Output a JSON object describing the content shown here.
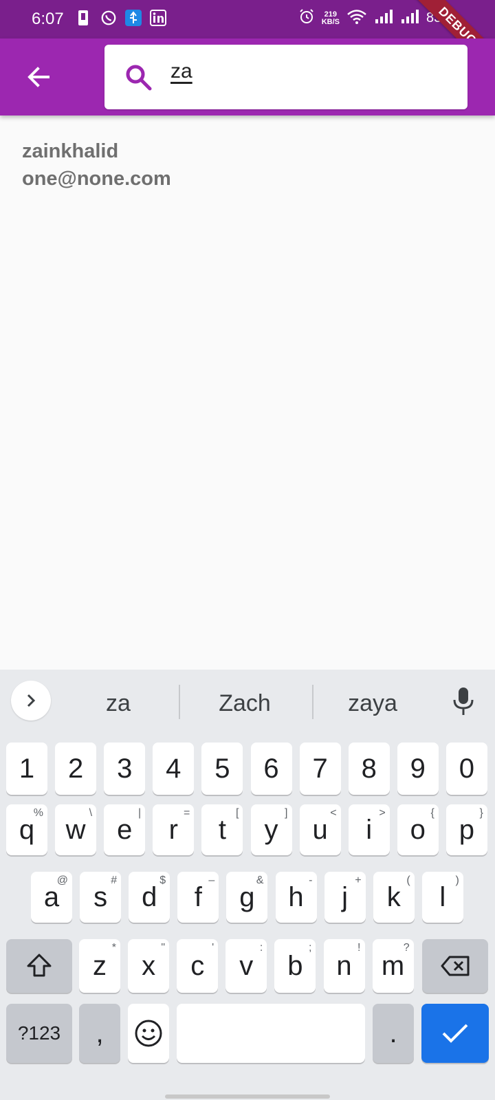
{
  "status": {
    "time": "6:07",
    "net_speed_top": "219",
    "net_speed_unit": "KB/S",
    "battery": "83%",
    "debug": "DEBUG"
  },
  "search": {
    "value": "za"
  },
  "result": {
    "name": "zainkhalid",
    "email": "one@none.com"
  },
  "keyboard": {
    "suggestions": [
      "za",
      "Zach",
      "zaya"
    ],
    "row_numbers": [
      "1",
      "2",
      "3",
      "4",
      "5",
      "6",
      "7",
      "8",
      "9",
      "0"
    ],
    "row1": [
      {
        "k": "q",
        "h": "%"
      },
      {
        "k": "w",
        "h": "\\"
      },
      {
        "k": "e",
        "h": "|"
      },
      {
        "k": "r",
        "h": "="
      },
      {
        "k": "t",
        "h": "["
      },
      {
        "k": "y",
        "h": "]"
      },
      {
        "k": "u",
        "h": "<"
      },
      {
        "k": "i",
        "h": ">"
      },
      {
        "k": "o",
        "h": "{"
      },
      {
        "k": "p",
        "h": "}"
      }
    ],
    "row2": [
      {
        "k": "a",
        "h": "@"
      },
      {
        "k": "s",
        "h": "#"
      },
      {
        "k": "d",
        "h": "$"
      },
      {
        "k": "f",
        "h": "–"
      },
      {
        "k": "g",
        "h": "&"
      },
      {
        "k": "h",
        "h": "-"
      },
      {
        "k": "j",
        "h": "+"
      },
      {
        "k": "k",
        "h": "("
      },
      {
        "k": "l",
        "h": ")"
      }
    ],
    "row3": [
      {
        "k": "z",
        "h": "*"
      },
      {
        "k": "x",
        "h": "\""
      },
      {
        "k": "c",
        "h": "'"
      },
      {
        "k": "v",
        "h": ":"
      },
      {
        "k": "b",
        "h": ";"
      },
      {
        "k": "n",
        "h": "!"
      },
      {
        "k": "m",
        "h": "?"
      }
    ],
    "symbols_label": "?123",
    "comma": ",",
    "period": "."
  },
  "colors": {
    "status_bar": "#7a1f8c",
    "app_bar": "#9c27b0",
    "accent": "#1a73e8"
  }
}
